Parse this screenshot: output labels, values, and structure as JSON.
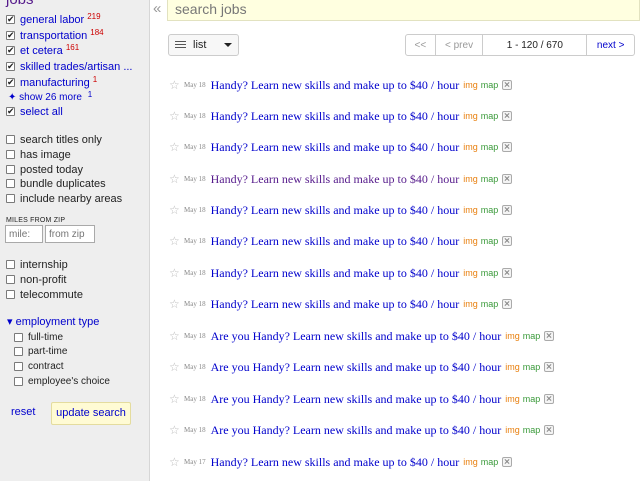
{
  "sidebar": {
    "title": "jobs",
    "categories": [
      {
        "label": "general labor",
        "count": "219"
      },
      {
        "label": "transportation",
        "count": "184"
      },
      {
        "label": "et cetera",
        "count": "161"
      },
      {
        "label": "skilled trades/artisan ...",
        "count": ""
      },
      {
        "label": "manufacturing",
        "count": "1"
      }
    ],
    "show_more": "✦ show 26 more",
    "show_more_count": "1",
    "select_all": "select all",
    "options": [
      "search titles only",
      "has image",
      "posted today",
      "bundle duplicates",
      "include nearby areas"
    ],
    "miles_label": "MILES FROM ZIP",
    "miles_placeholder": "mile:",
    "zip_placeholder": "from zip",
    "job_flags": [
      "internship",
      "non-profit",
      "telecommute"
    ],
    "employment_title": "▾ employment type",
    "employment_types": [
      "full-time",
      "part-time",
      "contract",
      "employee's choice"
    ],
    "reset": "reset",
    "update": "update search"
  },
  "search": {
    "placeholder": "search jobs",
    "collapse_icon": "«"
  },
  "toolbar": {
    "view_label": "list"
  },
  "pager": {
    "first": "<<",
    "prev": "< prev",
    "range": "1 - 120 / 670",
    "next": "next >"
  },
  "colors": {
    "link": "#0000cc",
    "visited": "#551a8b",
    "img_tag": "#e88010",
    "map_tag": "#3a9a3a",
    "button_bg": "#fffbd4",
    "sidebar_bg": "#eeeeee"
  },
  "results": [
    {
      "date": "May 18",
      "title": "Handy? Learn new skills and make up to $40 / hour",
      "img": "img",
      "map": "map",
      "visited": false
    },
    {
      "date": "May 18",
      "title": "Handy? Learn new skills and make up to $40 / hour",
      "img": "img",
      "map": "map",
      "visited": false
    },
    {
      "date": "May 18",
      "title": "Handy? Learn new skills and make up to $40 / hour",
      "img": "img",
      "map": "map",
      "visited": false
    },
    {
      "date": "May 18",
      "title": "Handy? Learn new skills and make up to $40 / hour",
      "img": "img",
      "map": "map",
      "visited": true
    },
    {
      "date": "May 18",
      "title": "Handy? Learn new skills and make up to $40 / hour",
      "img": "img",
      "map": "map",
      "visited": false
    },
    {
      "date": "May 18",
      "title": "Handy? Learn new skills and make up to $40 / hour",
      "img": "img",
      "map": "map",
      "visited": false
    },
    {
      "date": "May 18",
      "title": "Handy? Learn new skills and make up to $40 / hour",
      "img": "img",
      "map": "map",
      "visited": false
    },
    {
      "date": "May 18",
      "title": "Handy? Learn new skills and make up to $40 / hour",
      "img": "img",
      "map": "map",
      "visited": false
    },
    {
      "date": "May 18",
      "title": "Are you Handy? Learn new skills and make up to $40 / hour",
      "img": "img",
      "map": "map",
      "visited": false
    },
    {
      "date": "May 18",
      "title": "Are you Handy? Learn new skills and make up to $40 / hour",
      "img": "img",
      "map": "map",
      "visited": false
    },
    {
      "date": "May 18",
      "title": "Are you Handy? Learn new skills and make up to $40 / hour",
      "img": "img",
      "map": "map",
      "visited": false
    },
    {
      "date": "May 18",
      "title": "Are you Handy? Learn new skills and make up to $40 / hour",
      "img": "img",
      "map": "map",
      "visited": false
    },
    {
      "date": "May 17",
      "title": "Handy? Learn new skills and make up to $40 / hour",
      "img": "img",
      "map": "map",
      "visited": false
    }
  ]
}
